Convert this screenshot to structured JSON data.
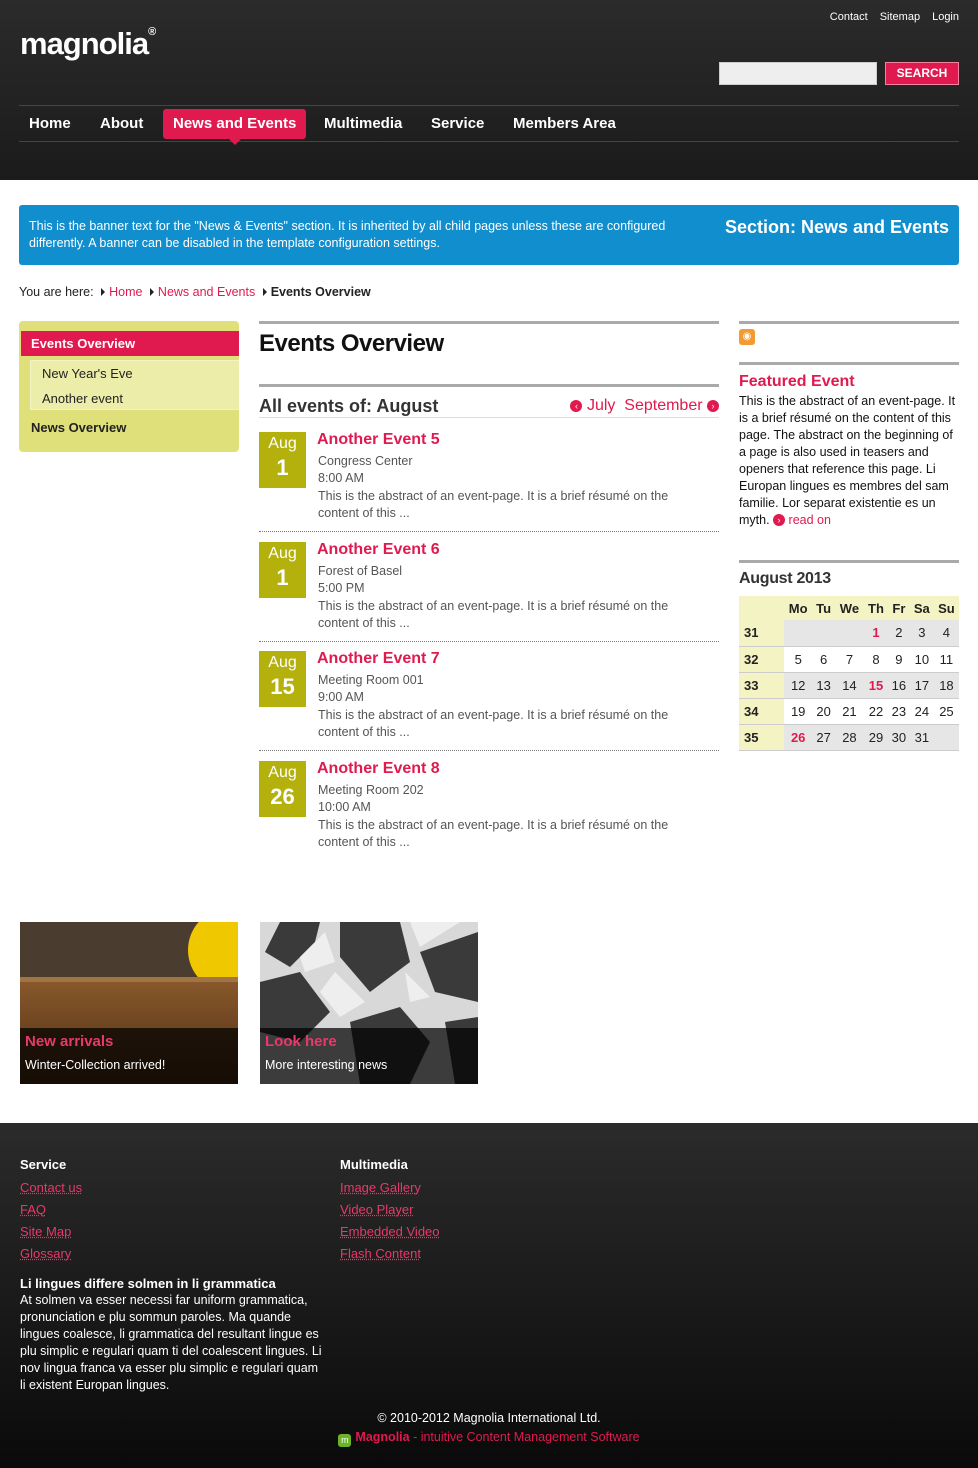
{
  "header": {
    "logo_text": "magnolia",
    "logo_mark": "®",
    "meta_nav": [
      "Contact",
      "Sitemap",
      "Login"
    ],
    "search_placeholder": "",
    "search_button": "SEARCH"
  },
  "nav": {
    "items": [
      "Home",
      "About",
      "News and Events",
      "Multimedia",
      "Service",
      "Members Area"
    ],
    "active": "News and Events"
  },
  "banner": {
    "text": "This is the banner text for the \"News & Events\" section. It is inherited by all child pages unless these are configured differently. A banner can be disabled in the template configuration settings.",
    "title": "Section: News and Events"
  },
  "breadcrumb": {
    "label": "You are here:",
    "items": [
      "Home",
      "News and Events"
    ],
    "current": "Events Overview"
  },
  "subnav": {
    "active": "Events Overview",
    "children": [
      "New Year's Eve",
      "Another event"
    ],
    "other": "News Overview"
  },
  "main": {
    "title": "Events Overview",
    "events_heading": "All events of: August",
    "prev_month": "July",
    "next_month": "September",
    "events": [
      {
        "month": "Aug",
        "day": "1",
        "title": "Another Event 5",
        "location": "Congress Center",
        "time": "8:00 AM",
        "abstract": "This is the abstract of an event-page. It is a brief résumé on the content of this ..."
      },
      {
        "month": "Aug",
        "day": "1",
        "title": "Another Event 6",
        "location": "Forest of Basel",
        "time": "5:00 PM",
        "abstract": "This is the abstract of an event-page. It is a brief résumé on the content of this ..."
      },
      {
        "month": "Aug",
        "day": "15",
        "title": "Another Event 7",
        "location": "Meeting Room 001",
        "time": "9:00 AM",
        "abstract": "This is the abstract of an event-page. It is a brief résumé on the content of this ..."
      },
      {
        "month": "Aug",
        "day": "26",
        "title": "Another Event 8",
        "location": "Meeting Room 202",
        "time": "10:00 AM",
        "abstract": "This is the abstract of an event-page. It is a brief résumé on the content of this ..."
      }
    ]
  },
  "sidebar": {
    "featured_title": "Featured Event",
    "featured_text": "This is the abstract of an event-page. It is a brief résumé on the content of this page. The abstract on the beginning of a page is also used in teasers and openers that reference this page. Li Europan lingues es membres del sam familie. Lor separat existentie es un myth.",
    "read_on": "read on",
    "calendar": {
      "title": "August 2013",
      "days": [
        "Mo",
        "Tu",
        "We",
        "Th",
        "Fr",
        "Sa",
        "Su"
      ],
      "weeks": [
        {
          "wk": "31",
          "days": [
            "",
            "",
            "",
            "1",
            "2",
            "3",
            "4"
          ]
        },
        {
          "wk": "32",
          "days": [
            "5",
            "6",
            "7",
            "8",
            "9",
            "10",
            "11"
          ]
        },
        {
          "wk": "33",
          "days": [
            "12",
            "13",
            "14",
            "15",
            "16",
            "17",
            "18"
          ]
        },
        {
          "wk": "34",
          "days": [
            "19",
            "20",
            "21",
            "22",
            "23",
            "24",
            "25"
          ]
        },
        {
          "wk": "35",
          "days": [
            "26",
            "27",
            "28",
            "29",
            "30",
            "31",
            ""
          ]
        }
      ],
      "event_days": [
        "1",
        "15",
        "26"
      ]
    }
  },
  "teasers": [
    {
      "title": "New arrivals",
      "subtitle": "Winter-Collection arrived!"
    },
    {
      "title": "Look here",
      "subtitle": "More interesting news"
    }
  ],
  "footer": {
    "col1": {
      "title": "Service",
      "links": [
        "Contact us",
        "FAQ",
        "Site Map",
        "Glossary"
      ]
    },
    "col2": {
      "title": "Multimedia",
      "links": [
        "Image Gallery",
        "Video Player",
        "Embedded Video",
        "Flash Content"
      ]
    },
    "about_title": "Li lingues differe solmen in li grammatica",
    "about_text": "At solmen va esser necessi far uniform grammatica, pronunciation e plu sommun paroles. Ma quande lingues coalesce, li grammatica del resultant lingue es plu simplic e regulari quam ti del coalescent lingues. Li nov lingua franca va esser plu simplic e regulari quam li existent Europan lingues.",
    "copyright": "© 2010-2012 Magnolia International Ltd.",
    "powered_brand": "Magnolia",
    "powered_text": " - intuitive Content Management Software"
  }
}
